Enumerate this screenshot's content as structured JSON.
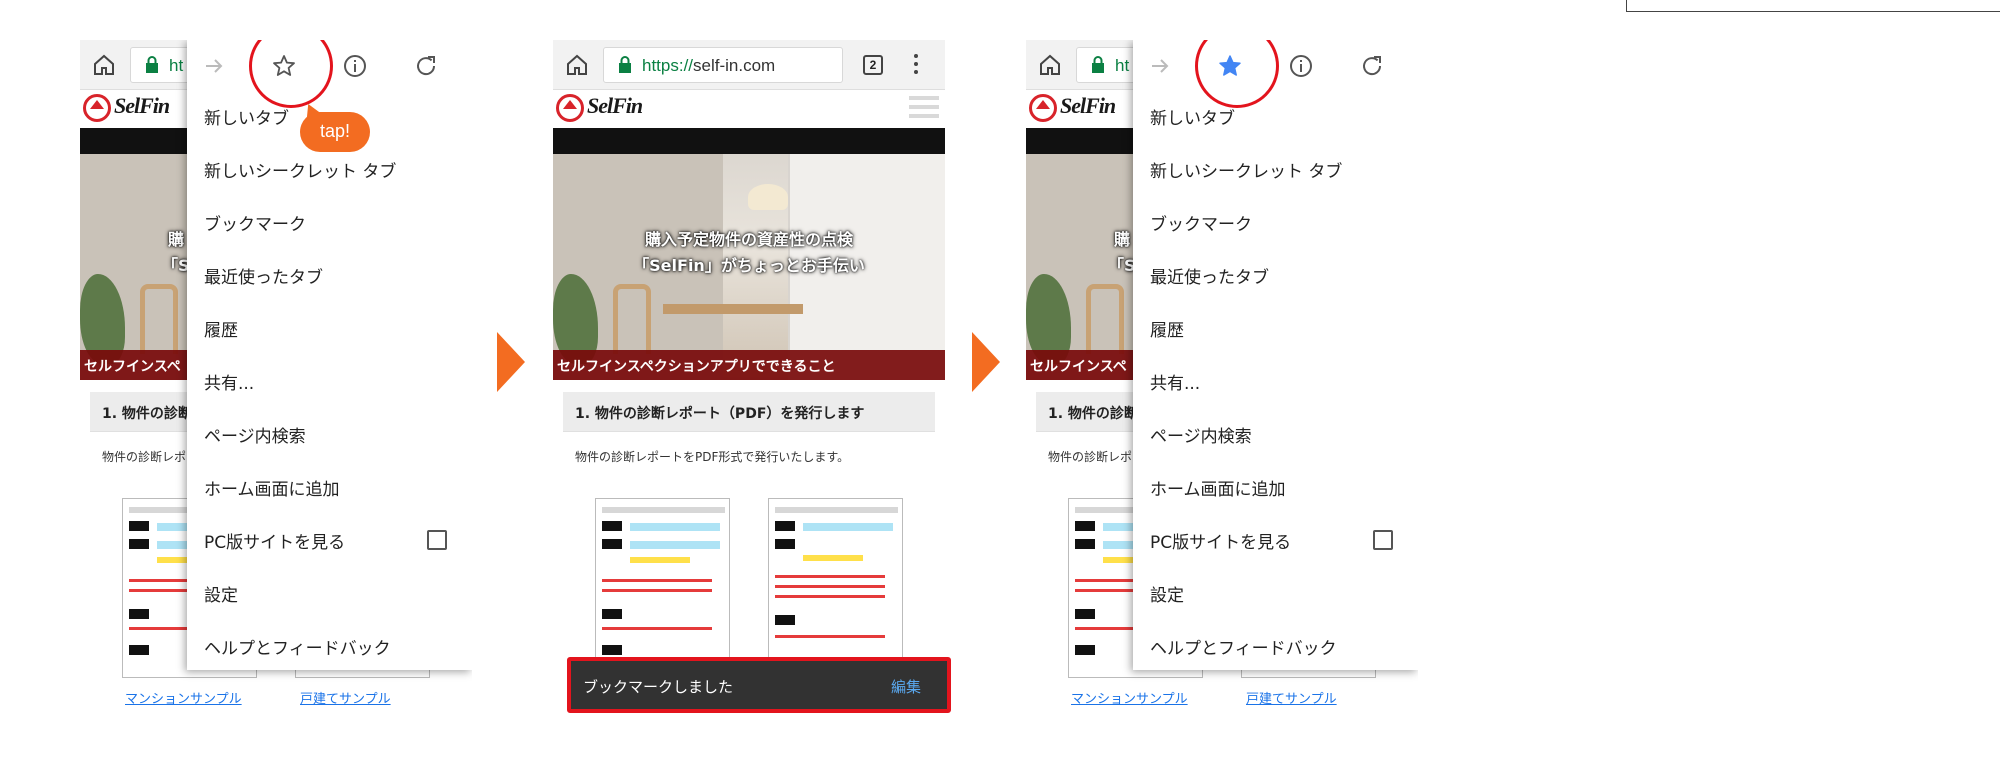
{
  "browser": {
    "url_scheme": "https://",
    "url_host": "self-in.com",
    "url_partial": "ht",
    "tab_count": "2"
  },
  "site": {
    "logo": "SelFin",
    "hero_line1": "購入予定物件の資産性の点検",
    "hero_line2": "「SelFin」がちょっとお手伝い",
    "hero_line1_partial": "購",
    "hero_line2_partial": "「S",
    "band": "セルフインスペクションアプリでできること",
    "band_partial": "セルフインスペ",
    "section_title": "1. 物件の診断レポート（PDF）を発行します",
    "section_title_partial": "1. 物件の診断",
    "section_desc": "物件の診断レポートをPDF形式で発行いたします。",
    "section_desc_partial": "物件の診断レポ",
    "link_condo": "マンションサンプル",
    "link_house": "戸建てサンプル"
  },
  "menu": {
    "items": [
      "新しいタブ",
      "新しいシークレット タブ",
      "ブックマーク",
      "最近使ったタブ",
      "履歴",
      "共有...",
      "ページ内検索",
      "ホーム画面に追加",
      "PC版サイトを見る",
      "設定",
      "ヘルプとフィードバック"
    ],
    "star_color_off": "#555555",
    "star_color_on": "#4285f4"
  },
  "annotation": {
    "tap": "tap!",
    "accent": "#f36c21",
    "highlight": "#e3141d"
  },
  "snackbar": {
    "text": "ブックマークしました",
    "action": "編集"
  }
}
